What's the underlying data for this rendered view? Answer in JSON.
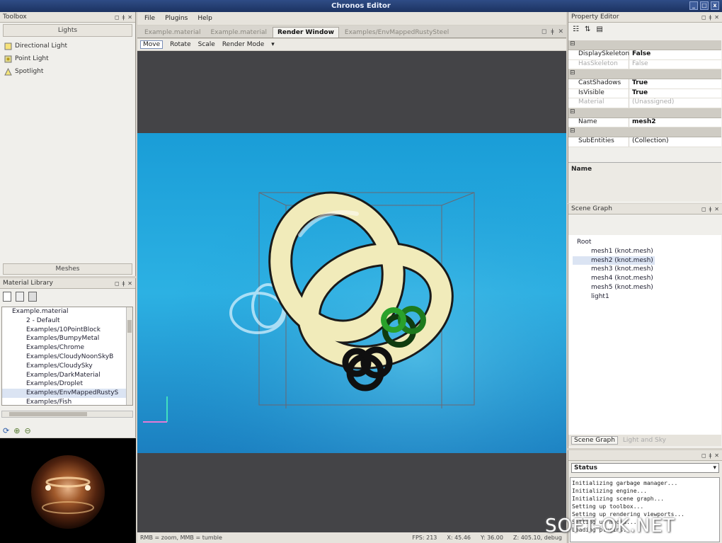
{
  "window": {
    "title": "Chronos Editor",
    "controls": [
      "_",
      "□",
      "x"
    ]
  },
  "toolbox": {
    "title": "Toolbox",
    "lights_tab": "Lights",
    "items": [
      {
        "label": "Directional Light",
        "icon": "directional-light-icon"
      },
      {
        "label": "Point Light",
        "icon": "point-light-icon"
      },
      {
        "label": "Spotlight",
        "icon": "spotlight-icon"
      }
    ],
    "meshes_tab": "Meshes"
  },
  "material_library": {
    "title": "Material Library",
    "tree": [
      "Example.material",
      "2 - Default",
      "Examples/10PointBlock",
      "Examples/BumpyMetal",
      "Examples/Chrome",
      "Examples/CloudyNoonSkyB",
      "Examples/CloudySky",
      "Examples/DarkMaterial",
      "Examples/Droplet",
      "Examples/EnvMappedRustyS",
      "Examples/Fish"
    ],
    "selected_index": 9
  },
  "menu": {
    "items": [
      "File",
      "Plugins",
      "Help"
    ]
  },
  "editor_tabs": {
    "tabs": [
      "Example.material",
      "Example.material",
      "Render Window",
      "Examples/EnvMappedRustySteel"
    ],
    "active_index": 2
  },
  "view_toolbar": {
    "items": [
      "Move",
      "Rotate",
      "Scale",
      "Render Mode",
      "▾"
    ],
    "active_index": 0
  },
  "status_bar": {
    "hint": "RMB = zoom, MMB = tumble",
    "fps": "FPS: 213",
    "x": "X: 45.46",
    "y": "Y: 36.00",
    "z": "Z: 405.10, debug"
  },
  "property_editor": {
    "title": "Property Editor",
    "groups": [
      {
        "rows": [
          {
            "key": "DisplaySkeleton",
            "value": "False",
            "dim": false
          },
          {
            "key": "HasSkeleton",
            "value": "False",
            "dim": true
          }
        ]
      },
      {
        "rows": [
          {
            "key": "CastShadows",
            "value": "True",
            "dim": false
          },
          {
            "key": "IsVisible",
            "value": "True",
            "dim": false
          },
          {
            "key": "Material",
            "value": "(Unassigned)",
            "dim": true
          }
        ]
      },
      {
        "rows": [
          {
            "key": "Name",
            "value": "mesh2",
            "dim": false
          }
        ]
      },
      {
        "rows": [
          {
            "key": "SubEntities",
            "value": "(Collection)",
            "dim": false,
            "plain": true
          }
        ]
      }
    ],
    "description_title": "Name"
  },
  "scene_graph": {
    "title": "Scene Graph",
    "nodes": [
      "Root",
      "mesh1 (knot.mesh)",
      "mesh2 (knot.mesh)",
      "mesh3 (knot.mesh)",
      "mesh4 (knot.mesh)",
      "mesh5 (knot.mesh)",
      "light1"
    ],
    "selected_index": 2,
    "tabs": [
      "Scene Graph",
      "Light and Sky"
    ]
  },
  "log": {
    "selector": "Status",
    "lines": [
      "Initializing garbage manager...",
      "Initializing engine...",
      "Initializing scene graph...",
      "Setting up toolbox...",
      "Setting up rendering viewports...",
      "Setting up media...",
      "Loading plugins..."
    ]
  },
  "watermark": "SOFT-OK.NET",
  "colors": {
    "accent": "#2f4d86",
    "viewport_bg": "#444447",
    "water": "#29a8dc",
    "knot": "#f1ebba"
  }
}
